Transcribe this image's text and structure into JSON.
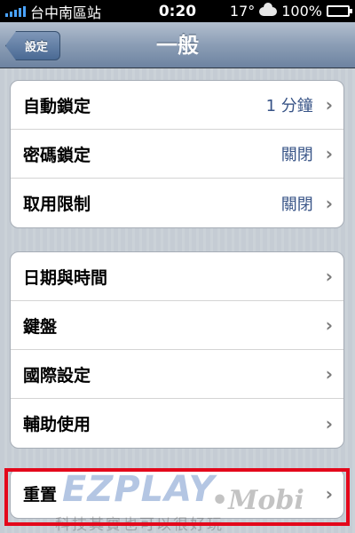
{
  "status_bar": {
    "carrier": "台中南區站",
    "time": "0:20",
    "temperature": "17°",
    "battery": "100%",
    "signal_color": "#4aa3ff",
    "battery_color": "#34c759"
  },
  "nav": {
    "title": "一般",
    "back_label": "設定"
  },
  "group1": {
    "items": [
      {
        "label": "自動鎖定",
        "value": "1 分鐘"
      },
      {
        "label": "密碼鎖定",
        "value": "關閉"
      },
      {
        "label": "取用限制",
        "value": "關閉"
      }
    ]
  },
  "group2": {
    "items": [
      {
        "label": "日期與時間"
      },
      {
        "label": "鍵盤"
      },
      {
        "label": "國際設定"
      },
      {
        "label": "輔助使用"
      }
    ]
  },
  "group3": {
    "items": [
      {
        "label": "重置"
      }
    ]
  },
  "chevron": "›",
  "highlight_color": "#e4071b",
  "watermark": {
    "main": "EZPLAY",
    "mobi": "•Mobi",
    "sub": "科技其實也可以很好玩"
  }
}
